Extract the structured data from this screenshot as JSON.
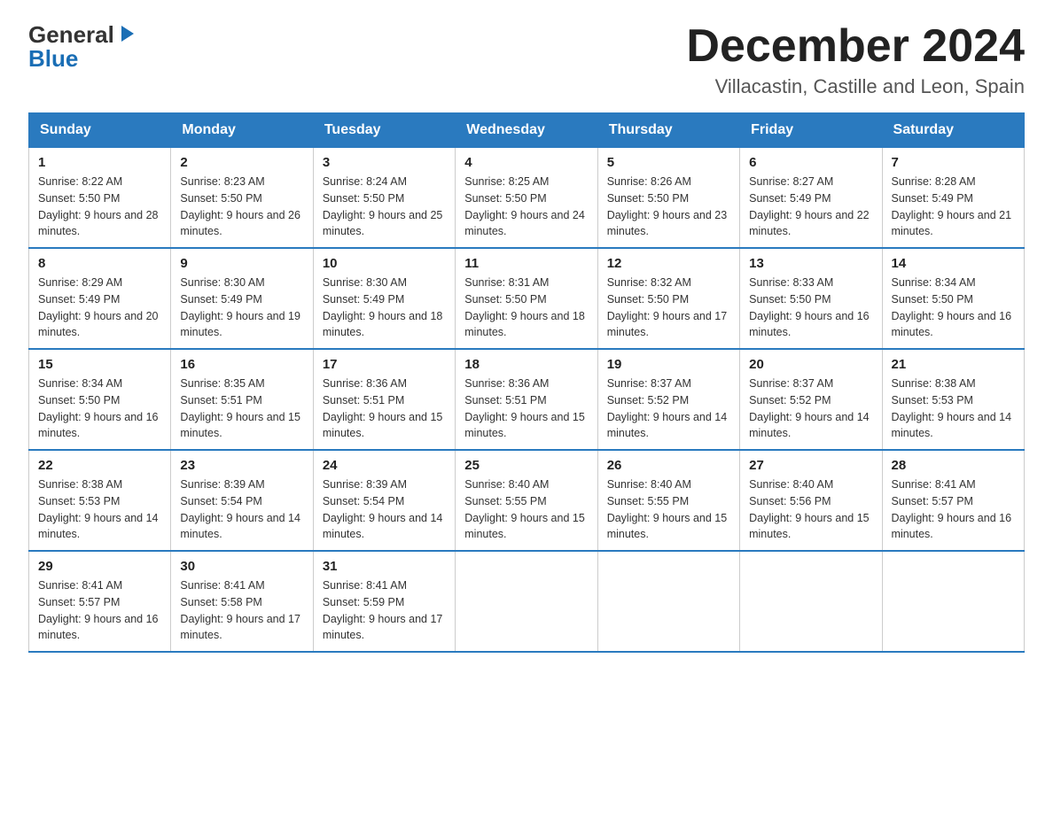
{
  "logo": {
    "general": "General",
    "blue": "Blue"
  },
  "header": {
    "month": "December 2024",
    "location": "Villacastin, Castille and Leon, Spain"
  },
  "days": {
    "headers": [
      "Sunday",
      "Monday",
      "Tuesday",
      "Wednesday",
      "Thursday",
      "Friday",
      "Saturday"
    ]
  },
  "weeks": [
    [
      {
        "num": "1",
        "sunrise": "Sunrise: 8:22 AM",
        "sunset": "Sunset: 5:50 PM",
        "daylight": "Daylight: 9 hours and 28 minutes."
      },
      {
        "num": "2",
        "sunrise": "Sunrise: 8:23 AM",
        "sunset": "Sunset: 5:50 PM",
        "daylight": "Daylight: 9 hours and 26 minutes."
      },
      {
        "num": "3",
        "sunrise": "Sunrise: 8:24 AM",
        "sunset": "Sunset: 5:50 PM",
        "daylight": "Daylight: 9 hours and 25 minutes."
      },
      {
        "num": "4",
        "sunrise": "Sunrise: 8:25 AM",
        "sunset": "Sunset: 5:50 PM",
        "daylight": "Daylight: 9 hours and 24 minutes."
      },
      {
        "num": "5",
        "sunrise": "Sunrise: 8:26 AM",
        "sunset": "Sunset: 5:50 PM",
        "daylight": "Daylight: 9 hours and 23 minutes."
      },
      {
        "num": "6",
        "sunrise": "Sunrise: 8:27 AM",
        "sunset": "Sunset: 5:49 PM",
        "daylight": "Daylight: 9 hours and 22 minutes."
      },
      {
        "num": "7",
        "sunrise": "Sunrise: 8:28 AM",
        "sunset": "Sunset: 5:49 PM",
        "daylight": "Daylight: 9 hours and 21 minutes."
      }
    ],
    [
      {
        "num": "8",
        "sunrise": "Sunrise: 8:29 AM",
        "sunset": "Sunset: 5:49 PM",
        "daylight": "Daylight: 9 hours and 20 minutes."
      },
      {
        "num": "9",
        "sunrise": "Sunrise: 8:30 AM",
        "sunset": "Sunset: 5:49 PM",
        "daylight": "Daylight: 9 hours and 19 minutes."
      },
      {
        "num": "10",
        "sunrise": "Sunrise: 8:30 AM",
        "sunset": "Sunset: 5:49 PM",
        "daylight": "Daylight: 9 hours and 18 minutes."
      },
      {
        "num": "11",
        "sunrise": "Sunrise: 8:31 AM",
        "sunset": "Sunset: 5:50 PM",
        "daylight": "Daylight: 9 hours and 18 minutes."
      },
      {
        "num": "12",
        "sunrise": "Sunrise: 8:32 AM",
        "sunset": "Sunset: 5:50 PM",
        "daylight": "Daylight: 9 hours and 17 minutes."
      },
      {
        "num": "13",
        "sunrise": "Sunrise: 8:33 AM",
        "sunset": "Sunset: 5:50 PM",
        "daylight": "Daylight: 9 hours and 16 minutes."
      },
      {
        "num": "14",
        "sunrise": "Sunrise: 8:34 AM",
        "sunset": "Sunset: 5:50 PM",
        "daylight": "Daylight: 9 hours and 16 minutes."
      }
    ],
    [
      {
        "num": "15",
        "sunrise": "Sunrise: 8:34 AM",
        "sunset": "Sunset: 5:50 PM",
        "daylight": "Daylight: 9 hours and 16 minutes."
      },
      {
        "num": "16",
        "sunrise": "Sunrise: 8:35 AM",
        "sunset": "Sunset: 5:51 PM",
        "daylight": "Daylight: 9 hours and 15 minutes."
      },
      {
        "num": "17",
        "sunrise": "Sunrise: 8:36 AM",
        "sunset": "Sunset: 5:51 PM",
        "daylight": "Daylight: 9 hours and 15 minutes."
      },
      {
        "num": "18",
        "sunrise": "Sunrise: 8:36 AM",
        "sunset": "Sunset: 5:51 PM",
        "daylight": "Daylight: 9 hours and 15 minutes."
      },
      {
        "num": "19",
        "sunrise": "Sunrise: 8:37 AM",
        "sunset": "Sunset: 5:52 PM",
        "daylight": "Daylight: 9 hours and 14 minutes."
      },
      {
        "num": "20",
        "sunrise": "Sunrise: 8:37 AM",
        "sunset": "Sunset: 5:52 PM",
        "daylight": "Daylight: 9 hours and 14 minutes."
      },
      {
        "num": "21",
        "sunrise": "Sunrise: 8:38 AM",
        "sunset": "Sunset: 5:53 PM",
        "daylight": "Daylight: 9 hours and 14 minutes."
      }
    ],
    [
      {
        "num": "22",
        "sunrise": "Sunrise: 8:38 AM",
        "sunset": "Sunset: 5:53 PM",
        "daylight": "Daylight: 9 hours and 14 minutes."
      },
      {
        "num": "23",
        "sunrise": "Sunrise: 8:39 AM",
        "sunset": "Sunset: 5:54 PM",
        "daylight": "Daylight: 9 hours and 14 minutes."
      },
      {
        "num": "24",
        "sunrise": "Sunrise: 8:39 AM",
        "sunset": "Sunset: 5:54 PM",
        "daylight": "Daylight: 9 hours and 14 minutes."
      },
      {
        "num": "25",
        "sunrise": "Sunrise: 8:40 AM",
        "sunset": "Sunset: 5:55 PM",
        "daylight": "Daylight: 9 hours and 15 minutes."
      },
      {
        "num": "26",
        "sunrise": "Sunrise: 8:40 AM",
        "sunset": "Sunset: 5:55 PM",
        "daylight": "Daylight: 9 hours and 15 minutes."
      },
      {
        "num": "27",
        "sunrise": "Sunrise: 8:40 AM",
        "sunset": "Sunset: 5:56 PM",
        "daylight": "Daylight: 9 hours and 15 minutes."
      },
      {
        "num": "28",
        "sunrise": "Sunrise: 8:41 AM",
        "sunset": "Sunset: 5:57 PM",
        "daylight": "Daylight: 9 hours and 16 minutes."
      }
    ],
    [
      {
        "num": "29",
        "sunrise": "Sunrise: 8:41 AM",
        "sunset": "Sunset: 5:57 PM",
        "daylight": "Daylight: 9 hours and 16 minutes."
      },
      {
        "num": "30",
        "sunrise": "Sunrise: 8:41 AM",
        "sunset": "Sunset: 5:58 PM",
        "daylight": "Daylight: 9 hours and 17 minutes."
      },
      {
        "num": "31",
        "sunrise": "Sunrise: 8:41 AM",
        "sunset": "Sunset: 5:59 PM",
        "daylight": "Daylight: 9 hours and 17 minutes."
      },
      null,
      null,
      null,
      null
    ]
  ]
}
